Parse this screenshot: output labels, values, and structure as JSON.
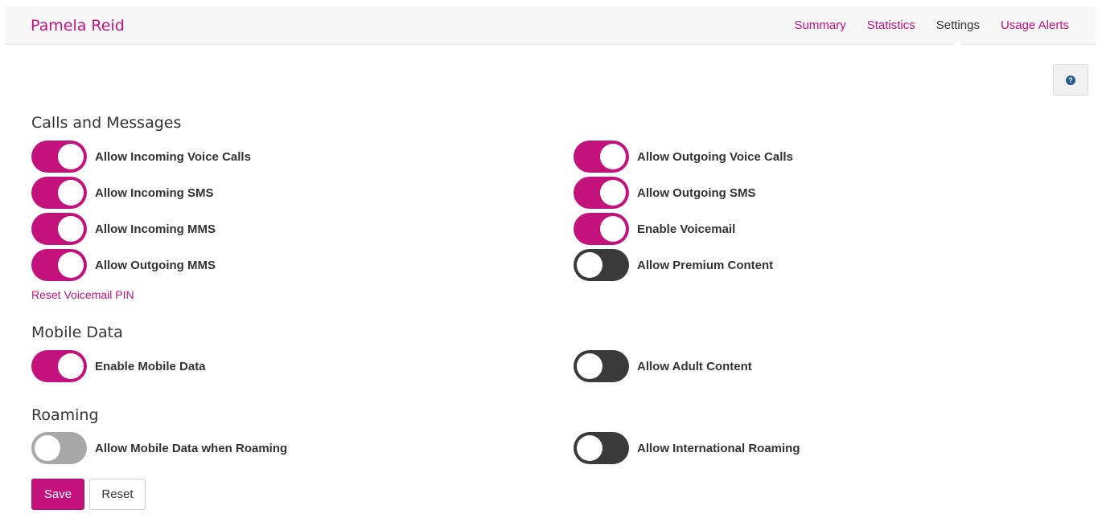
{
  "header": {
    "title": "Pamela Reid",
    "nav": [
      {
        "label": "Summary",
        "active": false
      },
      {
        "label": "Statistics",
        "active": false
      },
      {
        "label": "Settings",
        "active": true
      },
      {
        "label": "Usage Alerts",
        "active": false
      }
    ]
  },
  "help": {
    "icon": "question-circle-icon",
    "glyph": "?"
  },
  "sections": {
    "calls": {
      "title": "Calls and Messages",
      "toggles": [
        {
          "label": "Allow Incoming Voice Calls",
          "state": "on"
        },
        {
          "label": "Allow Outgoing Voice Calls",
          "state": "on"
        },
        {
          "label": "Allow Incoming SMS",
          "state": "on"
        },
        {
          "label": "Allow Outgoing SMS",
          "state": "on"
        },
        {
          "label": "Allow Incoming MMS",
          "state": "on"
        },
        {
          "label": "Enable Voicemail",
          "state": "on"
        },
        {
          "label": "Allow Outgoing MMS",
          "state": "on"
        },
        {
          "label": "Allow Premium Content",
          "state": "off"
        }
      ],
      "link": "Reset Voicemail PIN"
    },
    "data": {
      "title": "Mobile Data",
      "toggles": [
        {
          "label": "Enable Mobile Data",
          "state": "on"
        },
        {
          "label": "Allow Adult Content",
          "state": "off"
        }
      ]
    },
    "roaming": {
      "title": "Roaming",
      "toggles": [
        {
          "label": "Allow Mobile Data when Roaming",
          "state": "off-disabled"
        },
        {
          "label": "Allow International Roaming",
          "state": "off"
        }
      ]
    }
  },
  "buttons": {
    "save": "Save",
    "reset": "Reset"
  },
  "colors": {
    "accent": "#c4127d",
    "switch_off": "#3a3a3a",
    "switch_disabled": "#a8a8a8"
  }
}
